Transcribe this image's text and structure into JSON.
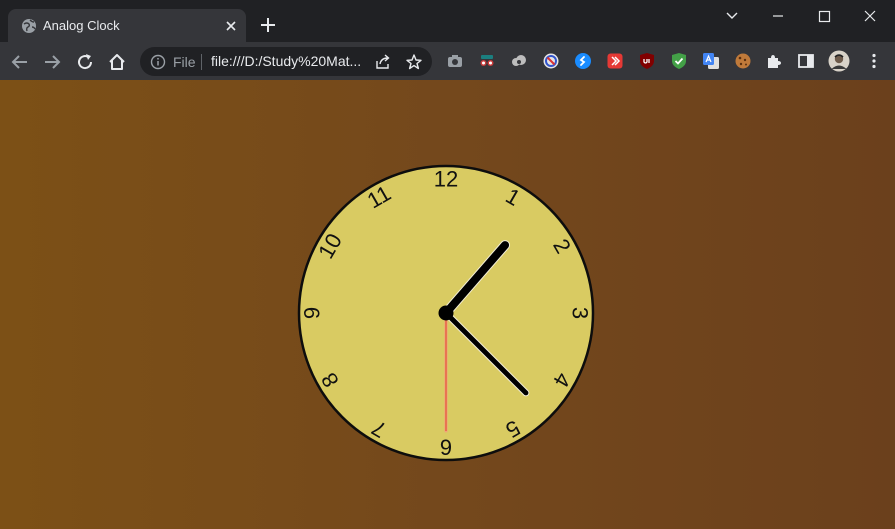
{
  "tab": {
    "title": "Analog Clock"
  },
  "address_bar": {
    "scheme": "File",
    "url": "file:///D:/Study%20Mat..."
  },
  "clock": {
    "numerals": [
      "12",
      "1",
      "2",
      "3",
      "4",
      "5",
      "6",
      "7",
      "8",
      "9",
      "10",
      "11"
    ],
    "time": {
      "hour": 1,
      "minute": 22,
      "second": 30
    },
    "colors": {
      "face": "#d9cb62",
      "rim": "#0d0d0d",
      "hands": "#000000",
      "second_hand": "#f2a27a",
      "background_left": "#7c5016",
      "background_right": "#6b401c"
    }
  },
  "icons": {
    "extensions": [
      "screenshot-camera-icon",
      "incognito-glasses-icon",
      "cloud-sync-icon",
      "blocker-circle-icon",
      "shazam-icon",
      "video-player-icon",
      "ublock-origin-icon",
      "shield-check-icon",
      "google-translate-icon",
      "cookie-icon",
      "puzzle-extensions-icon",
      "side-panel-icon",
      "profile-avatar",
      "more-menu-icon"
    ]
  }
}
